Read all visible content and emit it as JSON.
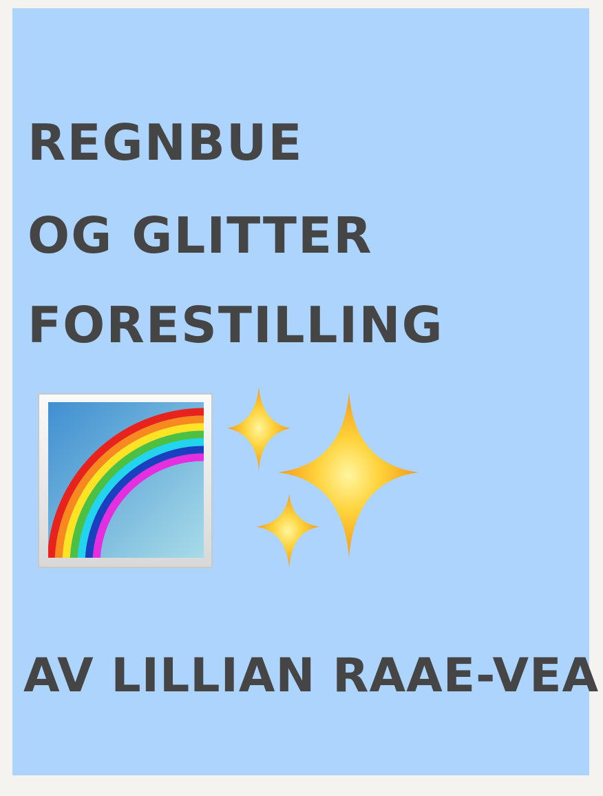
{
  "cover": {
    "title_lines": [
      "REGNBUE",
      "OG GLITTER",
      "FORESTILLING"
    ],
    "author": "AV LILLIAN RAAE-VEA"
  },
  "icons": {
    "rainbow": "rainbow-emoji-icon",
    "sparkles": "sparkles-emoji-icon"
  },
  "colors": {
    "background": "#add4fd",
    "text": "#454545",
    "page": "#f4f3f0"
  }
}
